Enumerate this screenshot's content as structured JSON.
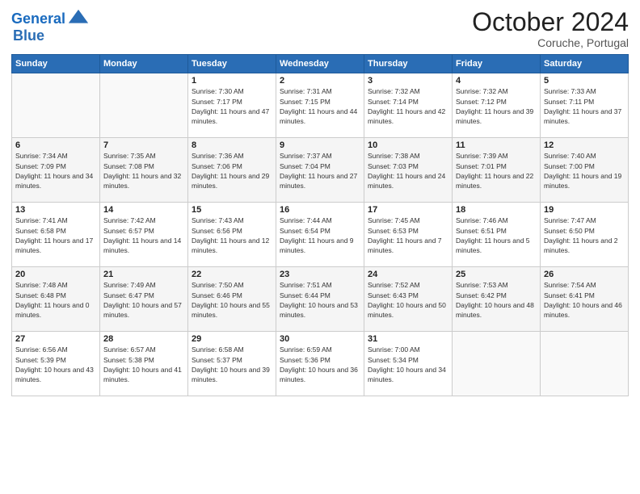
{
  "header": {
    "logo_line1": "General",
    "logo_line2": "Blue",
    "month": "October 2024",
    "location": "Coruche, Portugal"
  },
  "weekdays": [
    "Sunday",
    "Monday",
    "Tuesday",
    "Wednesday",
    "Thursday",
    "Friday",
    "Saturday"
  ],
  "weeks": [
    [
      {
        "day": "",
        "info": ""
      },
      {
        "day": "",
        "info": ""
      },
      {
        "day": "1",
        "info": "Sunrise: 7:30 AM\nSunset: 7:17 PM\nDaylight: 11 hours and 47 minutes."
      },
      {
        "day": "2",
        "info": "Sunrise: 7:31 AM\nSunset: 7:15 PM\nDaylight: 11 hours and 44 minutes."
      },
      {
        "day": "3",
        "info": "Sunrise: 7:32 AM\nSunset: 7:14 PM\nDaylight: 11 hours and 42 minutes."
      },
      {
        "day": "4",
        "info": "Sunrise: 7:32 AM\nSunset: 7:12 PM\nDaylight: 11 hours and 39 minutes."
      },
      {
        "day": "5",
        "info": "Sunrise: 7:33 AM\nSunset: 7:11 PM\nDaylight: 11 hours and 37 minutes."
      }
    ],
    [
      {
        "day": "6",
        "info": "Sunrise: 7:34 AM\nSunset: 7:09 PM\nDaylight: 11 hours and 34 minutes."
      },
      {
        "day": "7",
        "info": "Sunrise: 7:35 AM\nSunset: 7:08 PM\nDaylight: 11 hours and 32 minutes."
      },
      {
        "day": "8",
        "info": "Sunrise: 7:36 AM\nSunset: 7:06 PM\nDaylight: 11 hours and 29 minutes."
      },
      {
        "day": "9",
        "info": "Sunrise: 7:37 AM\nSunset: 7:04 PM\nDaylight: 11 hours and 27 minutes."
      },
      {
        "day": "10",
        "info": "Sunrise: 7:38 AM\nSunset: 7:03 PM\nDaylight: 11 hours and 24 minutes."
      },
      {
        "day": "11",
        "info": "Sunrise: 7:39 AM\nSunset: 7:01 PM\nDaylight: 11 hours and 22 minutes."
      },
      {
        "day": "12",
        "info": "Sunrise: 7:40 AM\nSunset: 7:00 PM\nDaylight: 11 hours and 19 minutes."
      }
    ],
    [
      {
        "day": "13",
        "info": "Sunrise: 7:41 AM\nSunset: 6:58 PM\nDaylight: 11 hours and 17 minutes."
      },
      {
        "day": "14",
        "info": "Sunrise: 7:42 AM\nSunset: 6:57 PM\nDaylight: 11 hours and 14 minutes."
      },
      {
        "day": "15",
        "info": "Sunrise: 7:43 AM\nSunset: 6:56 PM\nDaylight: 11 hours and 12 minutes."
      },
      {
        "day": "16",
        "info": "Sunrise: 7:44 AM\nSunset: 6:54 PM\nDaylight: 11 hours and 9 minutes."
      },
      {
        "day": "17",
        "info": "Sunrise: 7:45 AM\nSunset: 6:53 PM\nDaylight: 11 hours and 7 minutes."
      },
      {
        "day": "18",
        "info": "Sunrise: 7:46 AM\nSunset: 6:51 PM\nDaylight: 11 hours and 5 minutes."
      },
      {
        "day": "19",
        "info": "Sunrise: 7:47 AM\nSunset: 6:50 PM\nDaylight: 11 hours and 2 minutes."
      }
    ],
    [
      {
        "day": "20",
        "info": "Sunrise: 7:48 AM\nSunset: 6:48 PM\nDaylight: 11 hours and 0 minutes."
      },
      {
        "day": "21",
        "info": "Sunrise: 7:49 AM\nSunset: 6:47 PM\nDaylight: 10 hours and 57 minutes."
      },
      {
        "day": "22",
        "info": "Sunrise: 7:50 AM\nSunset: 6:46 PM\nDaylight: 10 hours and 55 minutes."
      },
      {
        "day": "23",
        "info": "Sunrise: 7:51 AM\nSunset: 6:44 PM\nDaylight: 10 hours and 53 minutes."
      },
      {
        "day": "24",
        "info": "Sunrise: 7:52 AM\nSunset: 6:43 PM\nDaylight: 10 hours and 50 minutes."
      },
      {
        "day": "25",
        "info": "Sunrise: 7:53 AM\nSunset: 6:42 PM\nDaylight: 10 hours and 48 minutes."
      },
      {
        "day": "26",
        "info": "Sunrise: 7:54 AM\nSunset: 6:41 PM\nDaylight: 10 hours and 46 minutes."
      }
    ],
    [
      {
        "day": "27",
        "info": "Sunrise: 6:56 AM\nSunset: 5:39 PM\nDaylight: 10 hours and 43 minutes."
      },
      {
        "day": "28",
        "info": "Sunrise: 6:57 AM\nSunset: 5:38 PM\nDaylight: 10 hours and 41 minutes."
      },
      {
        "day": "29",
        "info": "Sunrise: 6:58 AM\nSunset: 5:37 PM\nDaylight: 10 hours and 39 minutes."
      },
      {
        "day": "30",
        "info": "Sunrise: 6:59 AM\nSunset: 5:36 PM\nDaylight: 10 hours and 36 minutes."
      },
      {
        "day": "31",
        "info": "Sunrise: 7:00 AM\nSunset: 5:34 PM\nDaylight: 10 hours and 34 minutes."
      },
      {
        "day": "",
        "info": ""
      },
      {
        "day": "",
        "info": ""
      }
    ]
  ]
}
